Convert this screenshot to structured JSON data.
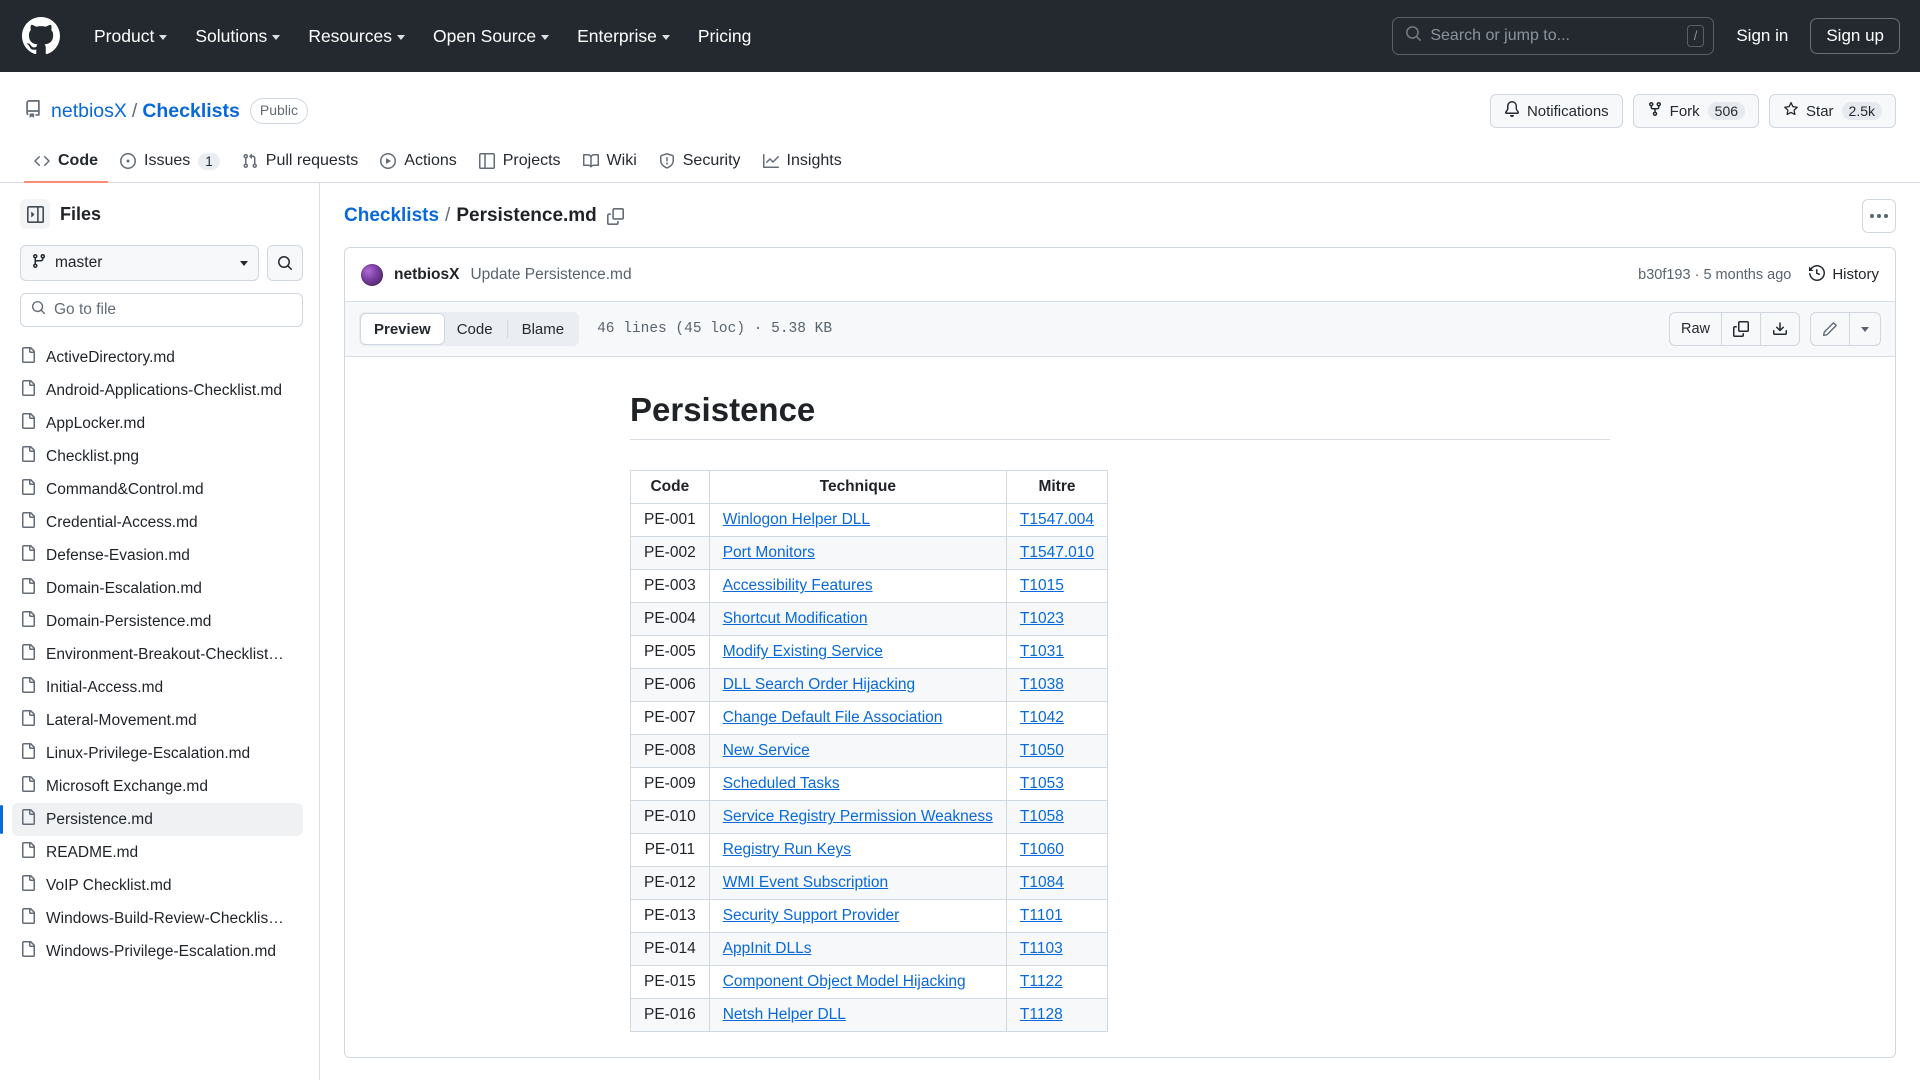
{
  "global_header": {
    "logo_icon": "github-mark-icon",
    "nav": [
      {
        "label": "Product",
        "has_caret": true
      },
      {
        "label": "Solutions",
        "has_caret": true
      },
      {
        "label": "Resources",
        "has_caret": true
      },
      {
        "label": "Open Source",
        "has_caret": true
      },
      {
        "label": "Enterprise",
        "has_caret": true
      },
      {
        "label": "Pricing",
        "has_caret": false
      }
    ],
    "search": {
      "placeholder": "Search or jump to...",
      "shortcut": "/",
      "icon": "search-icon"
    },
    "sign_in": "Sign in",
    "sign_up": "Sign up"
  },
  "repo": {
    "icon": "repo-icon",
    "owner": "netbiosX",
    "separator": "/",
    "name": "Checklists",
    "visibility": "Public",
    "actions": {
      "notifications": "Notifications",
      "fork_label": "Fork",
      "fork_count": "506",
      "star_label": "Star",
      "star_count": "2.5k"
    },
    "tabs": [
      {
        "label": "Code",
        "icon": "code-icon",
        "count": "",
        "active": true
      },
      {
        "label": "Issues",
        "icon": "issue-opened-icon",
        "count": "1",
        "active": false
      },
      {
        "label": "Pull requests",
        "icon": "git-pull-request-icon",
        "count": "",
        "active": false
      },
      {
        "label": "Actions",
        "icon": "play-icon",
        "count": "",
        "active": false
      },
      {
        "label": "Projects",
        "icon": "table-icon",
        "count": "",
        "active": false
      },
      {
        "label": "Wiki",
        "icon": "book-icon",
        "count": "",
        "active": false
      },
      {
        "label": "Security",
        "icon": "shield-icon",
        "count": "",
        "active": false
      },
      {
        "label": "Insights",
        "icon": "graph-icon",
        "count": "",
        "active": false
      }
    ]
  },
  "sidebar": {
    "title": "Files",
    "toggle_icon": "sidebar-collapse-icon",
    "branch": {
      "value": "master",
      "icon": "git-branch-icon"
    },
    "search_button_icon": "search-icon",
    "go_to_file_placeholder": "Go to file",
    "files": [
      {
        "name": "ActiveDirectory.md",
        "selected": false
      },
      {
        "name": "Android-Applications-Checklist.md",
        "selected": false
      },
      {
        "name": "AppLocker.md",
        "selected": false
      },
      {
        "name": "Checklist.png",
        "selected": false
      },
      {
        "name": "Command&Control.md",
        "selected": false
      },
      {
        "name": "Credential-Access.md",
        "selected": false
      },
      {
        "name": "Defense-Evasion.md",
        "selected": false
      },
      {
        "name": "Domain-Escalation.md",
        "selected": false
      },
      {
        "name": "Domain-Persistence.md",
        "selected": false
      },
      {
        "name": "Environment-Breakout-Checklist…",
        "selected": false
      },
      {
        "name": "Initial-Access.md",
        "selected": false
      },
      {
        "name": "Lateral-Movement.md",
        "selected": false
      },
      {
        "name": "Linux-Privilege-Escalation.md",
        "selected": false
      },
      {
        "name": "Microsoft Exchange.md",
        "selected": false
      },
      {
        "name": "Persistence.md",
        "selected": true
      },
      {
        "name": "README.md",
        "selected": false
      },
      {
        "name": "VoIP Checklist.md",
        "selected": false
      },
      {
        "name": "Windows-Build-Review-Checklis…",
        "selected": false
      },
      {
        "name": "Windows-Privilege-Escalation.md",
        "selected": false
      }
    ]
  },
  "breadcrumb": {
    "repo_link": "Checklists",
    "separator": "/",
    "current": "Persistence.md",
    "copy_icon": "copy-path-icon",
    "more_icon": "kebab-horizontal-icon"
  },
  "commit_bar": {
    "author": "netbiosX",
    "message": "Update Persistence.md",
    "sha": "b30f193",
    "sha_separator": "·",
    "relative_time": "5 months ago",
    "history_label": "History",
    "history_icon": "history-icon"
  },
  "file_toolbar": {
    "tabs": [
      {
        "label": "Preview",
        "active": true
      },
      {
        "label": "Code",
        "active": false
      },
      {
        "label": "Blame",
        "active": false
      }
    ],
    "meta": "46 lines (45 loc) · 5.38 KB",
    "raw_label": "Raw",
    "copy_icon": "copy-icon",
    "download_icon": "download-icon",
    "edit_icon": "pencil-icon",
    "edit_caret_icon": "chevron-down-icon"
  },
  "document": {
    "title": "Persistence",
    "table": {
      "headers": [
        "Code",
        "Technique",
        "Mitre"
      ],
      "rows": [
        {
          "code": "PE-001",
          "technique": "Winlogon Helper DLL",
          "mitre": "T1547.004"
        },
        {
          "code": "PE-002",
          "technique": "Port Monitors",
          "mitre": "T1547.010"
        },
        {
          "code": "PE-003",
          "technique": "Accessibility Features",
          "mitre": "T1015"
        },
        {
          "code": "PE-004",
          "technique": "Shortcut Modification",
          "mitre": "T1023"
        },
        {
          "code": "PE-005",
          "technique": "Modify Existing Service",
          "mitre": "T1031"
        },
        {
          "code": "PE-006",
          "technique": "DLL Search Order Hijacking",
          "mitre": "T1038"
        },
        {
          "code": "PE-007",
          "technique": "Change Default File Association",
          "mitre": "T1042"
        },
        {
          "code": "PE-008",
          "technique": "New Service",
          "mitre": "T1050"
        },
        {
          "code": "PE-009",
          "technique": "Scheduled Tasks",
          "mitre": "T1053"
        },
        {
          "code": "PE-010",
          "technique": "Service Registry Permission Weakness",
          "mitre": "T1058"
        },
        {
          "code": "PE-011",
          "technique": "Registry Run Keys",
          "mitre": "T1060"
        },
        {
          "code": "PE-012",
          "technique": "WMI Event Subscription",
          "mitre": "T1084"
        },
        {
          "code": "PE-013",
          "technique": "Security Support Provider",
          "mitre": "T1101"
        },
        {
          "code": "PE-014",
          "technique": "AppInit DLLs",
          "mitre": "T1103"
        },
        {
          "code": "PE-015",
          "technique": "Component Object Model Hijacking",
          "mitre": "T1122"
        },
        {
          "code": "PE-016",
          "technique": "Netsh Helper DLL",
          "mitre": "T1128"
        }
      ]
    }
  },
  "colors": {
    "header_bg": "#24292f",
    "link": "#0969da",
    "active_tab_underline": "#fd8c73",
    "border": "#d0d7de",
    "muted_text": "#59636e"
  }
}
